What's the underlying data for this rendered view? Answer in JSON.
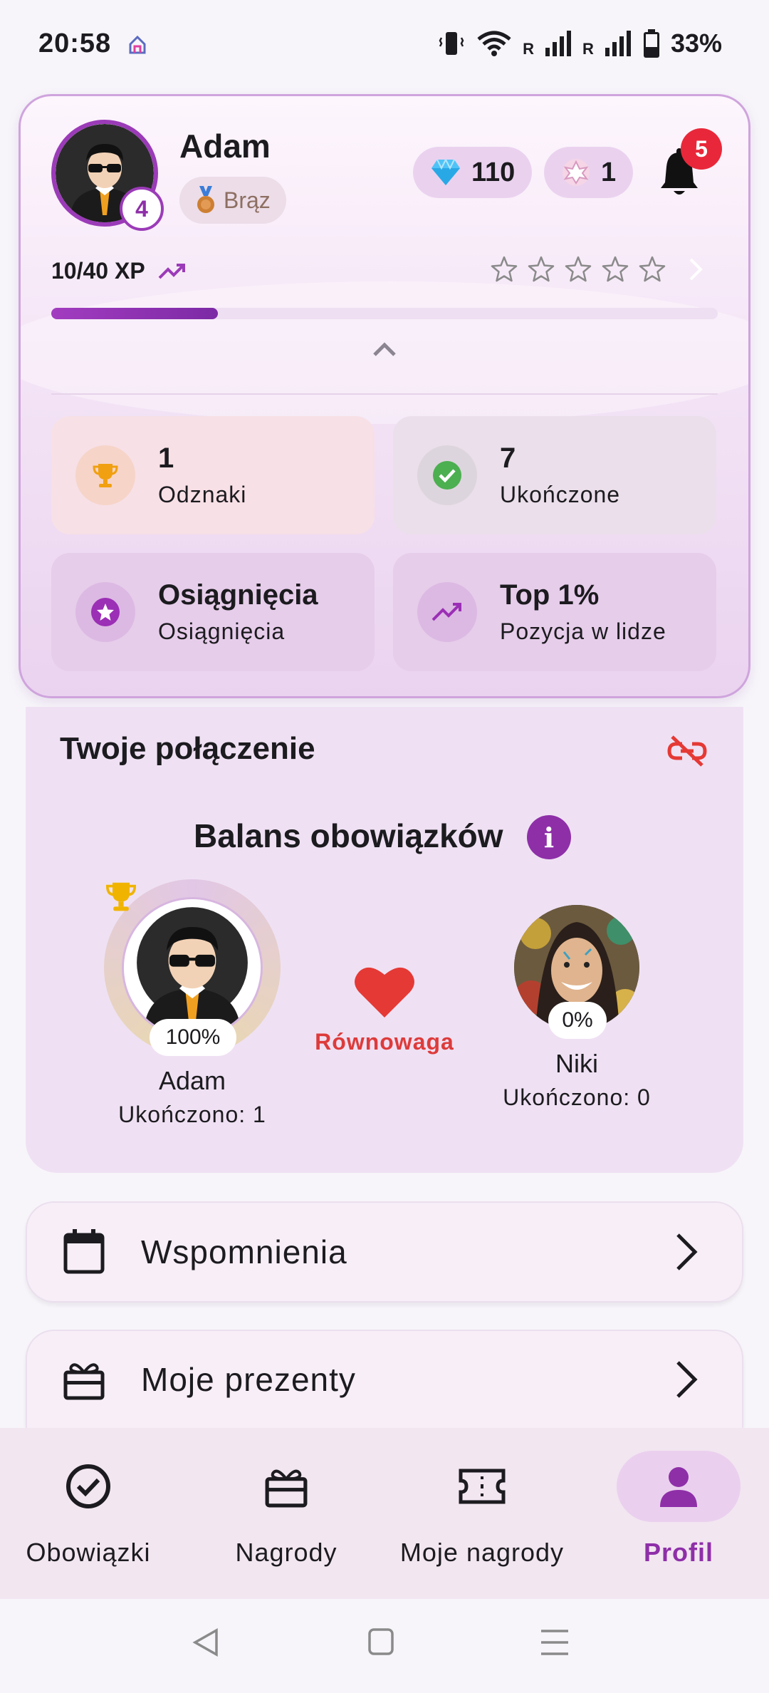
{
  "status_bar": {
    "time": "20:58",
    "battery": "33%",
    "signal_label_1": "R",
    "signal_label_2": "R"
  },
  "profile": {
    "name": "Adam",
    "level": "4",
    "rank": "Brąz",
    "gems": "110",
    "tokens": "1",
    "notifications": "5",
    "xp_text": "10/40 XP",
    "xp_progress": 0.25,
    "stars_filled": 0,
    "stars_total": 5
  },
  "stats": [
    {
      "value": "1",
      "label": "Odznaki",
      "icon": "trophy-icon"
    },
    {
      "value": "7",
      "label": "Ukończone",
      "icon": "check-circle-icon"
    },
    {
      "value": "Osiągnięcia",
      "label": "Osiągnięcia",
      "icon": "star-badge-icon"
    },
    {
      "value": "Top 1%",
      "label": "Pozycja w lidze",
      "icon": "trending-up-icon"
    }
  ],
  "connection": {
    "title": "Twoje połączenie",
    "balance_title": "Balans obowiązków",
    "status": "Równowaga",
    "me": {
      "name": "Adam",
      "percent": "100%",
      "completed": "Ukończono: 1"
    },
    "partner": {
      "name": "Niki",
      "percent": "0%",
      "completed": "Ukończono: 0"
    }
  },
  "menu": [
    {
      "label": "Wspomnienia",
      "icon": "calendar-icon"
    },
    {
      "label": "Moje prezenty",
      "icon": "gift-icon"
    }
  ],
  "nav": [
    {
      "label": "Obowiązki",
      "icon": "check-circle-icon"
    },
    {
      "label": "Nagrody",
      "icon": "gift-icon"
    },
    {
      "label": "Moje nagrody",
      "icon": "ticket-icon"
    },
    {
      "label": "Profil",
      "icon": "person-icon",
      "active": true
    }
  ],
  "colors": {
    "accent": "#8e2fa8",
    "badge_red": "#e8283a",
    "heart": "#e53935",
    "balance_status": "#dd3b3b"
  }
}
